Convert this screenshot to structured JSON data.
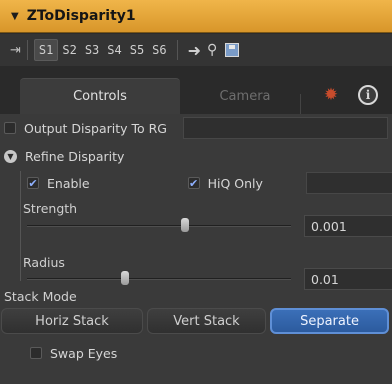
{
  "node": {
    "title": "ZToDisparity1"
  },
  "version_slots": [
    "S1",
    "S2",
    "S3",
    "S4",
    "S5",
    "S6"
  ],
  "active_slot": "S1",
  "tabs": {
    "controls": "Controls",
    "camera": "Camera",
    "active": "Controls"
  },
  "controls": {
    "output_disparity_to_rg": {
      "label": "Output Disparity To RG",
      "checked": false
    },
    "refine_disparity": {
      "label": "Refine Disparity",
      "expanded": true
    },
    "enable": {
      "label": "Enable",
      "checked": true
    },
    "hiq_only": {
      "label": "HiQ Only",
      "checked": true
    },
    "strength": {
      "label": "Strength",
      "value": "0.001",
      "level": 0.6
    },
    "radius": {
      "label": "Radius",
      "value": "0.01",
      "level": 0.37
    },
    "stack_mode": {
      "label": "Stack Mode",
      "options": [
        "Horiz Stack",
        "Vert Stack",
        "Separate"
      ],
      "selected": "Separate"
    },
    "swap_eyes": {
      "label": "Swap Eyes",
      "checked": false
    }
  },
  "colors": {
    "title_bar": "#e0a43a",
    "selected_button": "#3468ad",
    "check": "#8fb1ff",
    "gear": "#c94c2c"
  }
}
